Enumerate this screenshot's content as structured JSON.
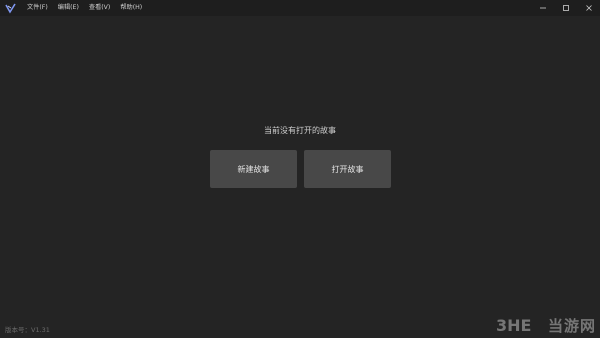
{
  "menu": [
    {
      "label": "文件(F)"
    },
    {
      "label": "编辑(E)"
    },
    {
      "label": "查看(V)"
    },
    {
      "label": "帮助(H)"
    }
  ],
  "window_controls": {
    "minimize_icon": "minimize-icon",
    "maximize_icon": "maximize-icon",
    "close_icon": "close-icon"
  },
  "main": {
    "message": "当前没有打开的故事",
    "new_story_label": "新建故事",
    "open_story_label": "打开故事"
  },
  "footer": {
    "version": "版本号：V1.31"
  },
  "watermark": {
    "logo": "3HE",
    "text": "当游网"
  },
  "colors": {
    "background": "#242424",
    "titlebar": "#1e1e1e",
    "button": "#484848",
    "accent": "#6f8ff0"
  }
}
